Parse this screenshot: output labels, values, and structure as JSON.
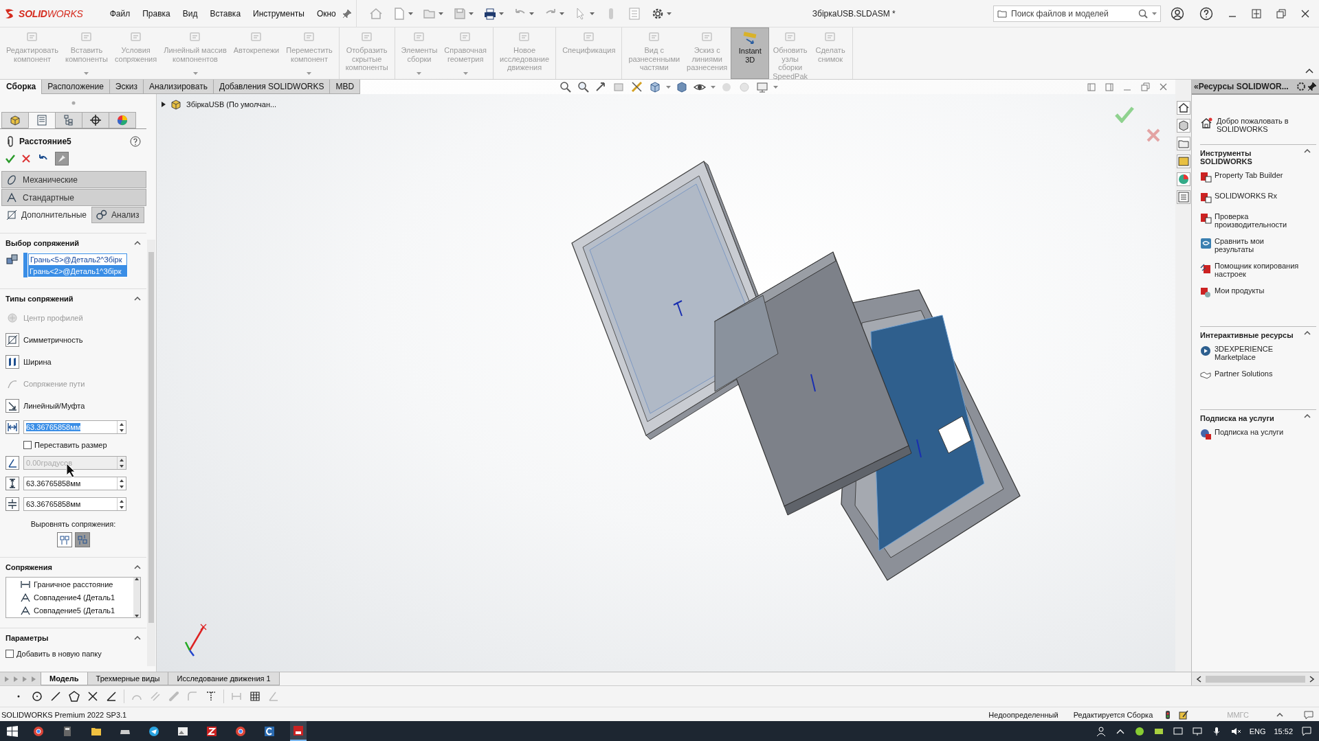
{
  "app": {
    "logo": "**SOLID**WORKS",
    "menu": [
      "Файл",
      "Правка",
      "Вид",
      "Вставка",
      "Инструменты",
      "Окно"
    ],
    "document_title": "ЗбіркаUSB.SLDASM *",
    "search": {
      "placeholder": "Поиск файлов и моделей"
    }
  },
  "ribbon": [
    {
      "buttons": [
        {
          "label": "Редактировать\nкомпонент",
          "disabled": true,
          "dropdown": false
        },
        {
          "label": "Вставить\nкомпоненты",
          "disabled": true,
          "dropdown": true
        },
        {
          "label": "Условия\nсопряжения",
          "disabled": true,
          "dropdown": false
        },
        {
          "label": "Линейный массив\nкомпонентов",
          "disabled": true,
          "dropdown": true
        },
        {
          "label": "Автокрепежи",
          "disabled": true,
          "dropdown": false
        },
        {
          "label": "Переместить\nкомпонент",
          "disabled": true,
          "dropdown": true
        }
      ]
    },
    {
      "buttons": [
        {
          "label": "Отобразить\nскрытые\nкомпоненты",
          "disabled": true,
          "dropdown": false
        }
      ]
    },
    {
      "buttons": [
        {
          "label": "Элементы\nсборки",
          "disabled": true,
          "dropdown": true
        },
        {
          "label": "Справочная\nгеометрия",
          "disabled": true,
          "dropdown": true
        }
      ]
    },
    {
      "buttons": [
        {
          "label": "Новое\nисследование\nдвижения",
          "disabled": true,
          "dropdown": false
        }
      ]
    },
    {
      "buttons": [
        {
          "label": "Спецификация",
          "disabled": true,
          "dropdown": false
        }
      ]
    },
    {
      "buttons": [
        {
          "label": "Вид с\nразнесенными\nчастями",
          "disabled": true,
          "dropdown": false
        },
        {
          "label": "Эскиз с\nлиниями\nразнесения",
          "disabled": true,
          "dropdown": false
        },
        {
          "label": "Instant\n3D",
          "disabled": false,
          "dropdown": false,
          "selected": true
        },
        {
          "label": "Обновить\nузлы\nсборки\nSpeedPak",
          "disabled": true,
          "dropdown": false
        },
        {
          "label": "Сделать\nснимок",
          "disabled": true,
          "dropdown": false
        }
      ]
    }
  ],
  "command_tabs": [
    {
      "label": "Сборка",
      "selected": true
    },
    {
      "label": "Расположение",
      "selected": false
    },
    {
      "label": "Эскиз",
      "selected": false
    },
    {
      "label": "Анализировать",
      "selected": false
    },
    {
      "label": "Добавления SOLIDWORKS",
      "selected": false
    },
    {
      "label": "MBD",
      "selected": false
    }
  ],
  "feature_tree": {
    "root": "ЗбіркаUSB (По умолчан...",
    "expanded": false
  },
  "property_manager": {
    "panel_tabs": [
      {
        "selected": false
      },
      {
        "selected": true
      },
      {
        "selected": false
      },
      {
        "selected": false
      },
      {
        "selected": false
      }
    ],
    "title": "Расстояние5",
    "mate_groups": [
      {
        "label": "Механические"
      },
      {
        "label": "Стандартные"
      }
    ],
    "mate_tabs": [
      {
        "label": "Дополнительные",
        "selected": true
      },
      {
        "label": "Анализ",
        "selected": false
      }
    ],
    "selection": {
      "title": "Выбор сопряжений",
      "expanded": true,
      "items": [
        {
          "label": "Грань<5>@Деталь2^Збірк",
          "selected": false
        },
        {
          "label": "Грань<2>@Деталь1^Збірк",
          "selected": true
        }
      ]
    },
    "mate_types": {
      "title": "Типы сопряжений",
      "expanded": true,
      "options": [
        {
          "label": "Центр профилей",
          "disabled": true
        },
        {
          "label": "Симметричность",
          "disabled": false
        },
        {
          "label": "Ширина",
          "disabled": false
        },
        {
          "label": "Сопряжение пути",
          "disabled": true
        },
        {
          "label": "Линейный/Муфта",
          "disabled": false
        }
      ],
      "distance": {
        "value": "63.36765858мм",
        "highlighted": true
      },
      "flip": {
        "label": "Переставить размер",
        "checked": false
      },
      "angle": {
        "value": "0.00градусов",
        "disabled": true
      },
      "limits": [
        {
          "value": "63.36765858мм"
        },
        {
          "value": "63.36765858мм"
        }
      ],
      "align_label": "Выровнять сопряжения:",
      "align_buttons": [
        {
          "selected": false
        },
        {
          "selected": true
        }
      ]
    },
    "mates": {
      "title": "Сопряжения",
      "expanded": true,
      "items": [
        "Граничное расстояние",
        "Совпадение4 (Деталь1",
        "Совпадение5 (Деталь1"
      ]
    },
    "options": {
      "title": "Параметры",
      "expanded": true,
      "checkbox": {
        "label": "Добавить в новую папку",
        "checked": false
      }
    }
  },
  "task_pane": {
    "title": "«Ресурсы SOLIDWOR...",
    "welcome": "Добро пожаловать в SOLIDWORKS",
    "sections": [
      {
        "title": "Инструменты SOLIDWORKS",
        "expanded": true,
        "items": [
          "Property Tab Builder",
          "SOLIDWORKS Rx",
          "Проверка производительности",
          "Сравнить мои результаты",
          "Помощник копирования настроек",
          "Мои продукты"
        ]
      },
      {
        "title": "Интерактивные ресурсы",
        "expanded": true,
        "items": [
          "3DEXPERIENCE Marketplace",
          "Partner Solutions"
        ]
      },
      {
        "title": "Подписка на услуги",
        "expanded": true,
        "items": [
          "Подписка на услуги"
        ]
      }
    ]
  },
  "bottom_tabs": [
    {
      "label": "Модель",
      "selected": true
    },
    {
      "label": "Трехмерные виды",
      "selected": false
    },
    {
      "label": "Исследование движения 1",
      "selected": false
    }
  ],
  "status_bar": {
    "product": "SOLIDWORKS Premium 2022 SP3.1",
    "definition": "Недоопределенный",
    "mode": "Редактируется Сборка",
    "units": "ММГС"
  },
  "taskbar": {
    "language": "ENG",
    "time": "15:52"
  }
}
